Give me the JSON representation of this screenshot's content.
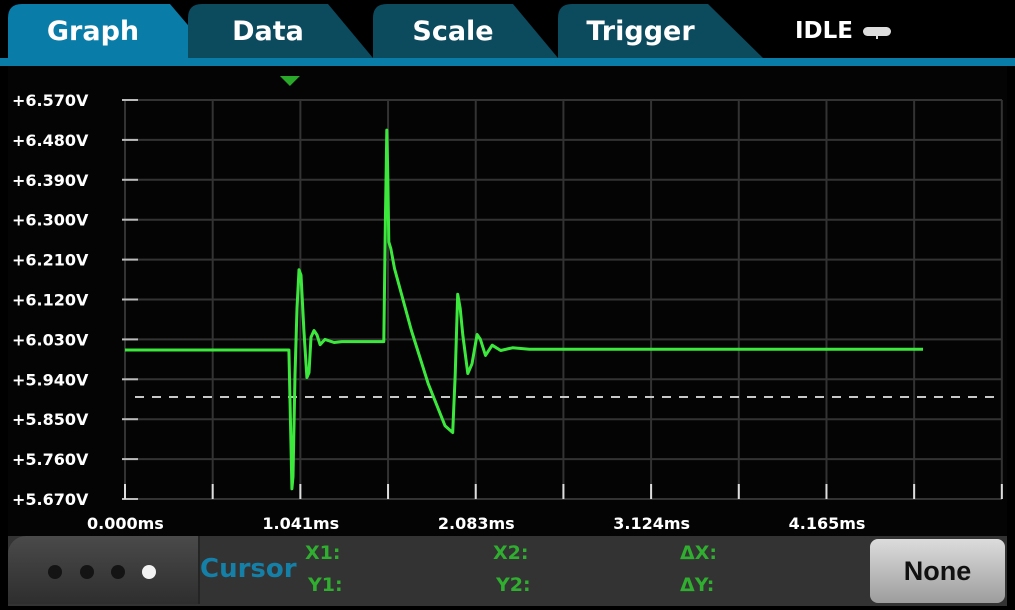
{
  "tabs": [
    {
      "label": "Graph",
      "active": true
    },
    {
      "label": "Data",
      "active": false
    },
    {
      "label": "Scale",
      "active": false
    },
    {
      "label": "Trigger",
      "active": false
    }
  ],
  "status": {
    "label": "IDLE",
    "icon": "idle-indicator-icon"
  },
  "colors": {
    "active_tab": "#0a7ca8",
    "inactive_tab": "#0c4a5e",
    "trace": "#3de83d",
    "trigger_marker": "#2aa82a",
    "cursor_label": "#1480a8",
    "cursor_fields": "#2fae2f"
  },
  "chart_data": {
    "type": "line",
    "title": "",
    "xlabel": "",
    "ylabel": "",
    "x_unit": "ms",
    "y_unit": "V",
    "xlim": [
      0,
      5.206
    ],
    "ylim": [
      5.67,
      6.57
    ],
    "grid": true,
    "x_ticks": [
      "0.000ms",
      "1.041ms",
      "2.083ms",
      "3.124ms",
      "4.165ms"
    ],
    "x_tick_values": [
      0,
      1.041,
      2.083,
      3.124,
      4.165
    ],
    "y_ticks": [
      "+6.570V",
      "+6.480V",
      "+6.390V",
      "+6.300V",
      "+6.210V",
      "+6.120V",
      "+6.030V",
      "+5.940V",
      "+5.850V",
      "+5.760V",
      "+5.670V"
    ],
    "y_tick_values": [
      6.57,
      6.48,
      6.39,
      6.3,
      6.21,
      6.12,
      6.03,
      5.94,
      5.85,
      5.76,
      5.67
    ],
    "trigger_level_v": 5.9,
    "trigger_position_ms": 0.973,
    "series": [
      {
        "name": "Voltage",
        "x": [
          0.0,
          0.967,
          0.973,
          0.985,
          0.991,
          0.997,
          1.009,
          1.021,
          1.033,
          1.045,
          1.062,
          1.08,
          1.092,
          1.104,
          1.122,
          1.14,
          1.158,
          1.187,
          1.241,
          1.288,
          1.536,
          1.546,
          1.554,
          1.56,
          1.566,
          1.578,
          1.6,
          1.7,
          1.8,
          1.9,
          1.945,
          1.96,
          1.975,
          1.99,
          2.005,
          2.035,
          2.06,
          2.09,
          2.11,
          2.14,
          2.18,
          2.23,
          2.3,
          2.4,
          2.6,
          3.0,
          3.5,
          4.0,
          4.5,
          4.737
        ],
        "y": [
          6.006,
          6.006,
          6.006,
          5.8,
          5.693,
          5.72,
          5.95,
          6.1,
          6.187,
          6.175,
          6.05,
          5.944,
          5.955,
          6.035,
          6.05,
          6.04,
          6.018,
          6.03,
          6.023,
          6.025,
          6.025,
          6.3,
          6.502,
          6.4,
          6.25,
          6.235,
          6.19,
          6.05,
          5.93,
          5.835,
          5.82,
          5.95,
          6.132,
          6.1,
          6.04,
          5.953,
          5.975,
          6.041,
          6.03,
          5.994,
          6.017,
          6.005,
          6.011,
          6.008,
          6.008,
          6.008,
          6.008,
          6.008,
          6.008,
          6.008
        ]
      }
    ]
  },
  "bottom": {
    "page_dots": 4,
    "active_dot": 4,
    "cursor_label": "Cursor",
    "x1_label": "X1:",
    "y1_label": "Y1:",
    "x2_label": "X2:",
    "y2_label": "Y2:",
    "dx_label": "ΔX:",
    "dy_label": "ΔY:",
    "none_button": "None"
  }
}
